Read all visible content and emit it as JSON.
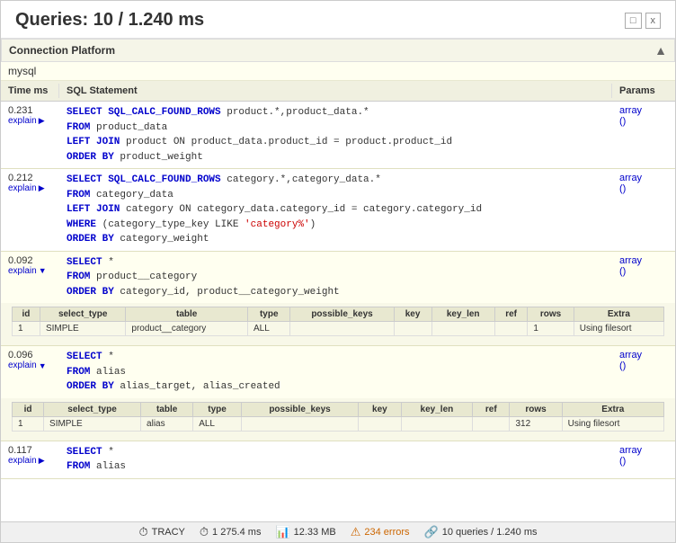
{
  "title": "Queries: 10 / 1.240 ms",
  "window_controls": [
    "□",
    "x"
  ],
  "connection": {
    "platform_label": "Connection Platform",
    "db_name": "mysql"
  },
  "table_headers": {
    "time": "Time ms",
    "sql": "SQL Statement",
    "params": "Params"
  },
  "queries": [
    {
      "id": "q1",
      "time": "0.231",
      "explain_label": "explain",
      "explain_open": false,
      "sql_lines": [
        {
          "type": "keyword",
          "text": "SELECT SQL_CALC_FOUND_ROWS ",
          "rest": "product.*,product_data.*"
        },
        {
          "type": "keyword2",
          "text": "FROM ",
          "rest": "product_data"
        },
        {
          "type": "keyword2",
          "text": "LEFT JOIN ",
          "rest": "product ON product_data.product_id = product.product_id"
        },
        {
          "type": "keyword2",
          "text": "ORDER BY ",
          "rest": "product_weight"
        }
      ],
      "params": "array\n()"
    },
    {
      "id": "q2",
      "time": "0.212",
      "explain_label": "explain",
      "explain_open": false,
      "sql_lines": [
        {
          "type": "keyword",
          "text": "SELECT SQL_CALC_FOUND_ROWS ",
          "rest": "category.*,category_data.*"
        },
        {
          "type": "keyword2",
          "text": "FROM ",
          "rest": "category_data"
        },
        {
          "type": "keyword2",
          "text": "LEFT JOIN ",
          "rest": "category ON category_data.category_id = category.category_id"
        },
        {
          "type": "keyword2",
          "text": "WHERE ",
          "rest": "(category_type_key LIKE 'category%')"
        },
        {
          "type": "keyword2",
          "text": "ORDER BY ",
          "rest": "category_weight"
        }
      ],
      "params": "array\n()"
    },
    {
      "id": "q3",
      "time": "0.092",
      "explain_label": "explain",
      "explain_open": true,
      "sql_lines": [
        {
          "type": "keyword",
          "text": "SELECT ",
          "rest": "*"
        },
        {
          "type": "keyword2",
          "text": "FROM ",
          "rest": "product__category"
        },
        {
          "type": "keyword2",
          "text": "ORDER BY ",
          "rest": "category_id, product__category_weight"
        }
      ],
      "params": "array\n()",
      "explain_data": {
        "headers": [
          "id",
          "select_type",
          "table",
          "type",
          "possible_keys",
          "key",
          "key_len",
          "ref",
          "rows",
          "Extra"
        ],
        "rows": [
          [
            "1",
            "SIMPLE",
            "product__category",
            "ALL",
            "",
            "",
            "",
            "",
            "1",
            "Using filesort"
          ]
        ]
      }
    },
    {
      "id": "q4",
      "time": "0.096",
      "explain_label": "explain",
      "explain_open": true,
      "sql_lines": [
        {
          "type": "keyword",
          "text": "SELECT ",
          "rest": "*"
        },
        {
          "type": "keyword2",
          "text": "FROM ",
          "rest": "alias"
        },
        {
          "type": "keyword2",
          "text": "ORDER BY ",
          "rest": "alias_target, alias_created"
        }
      ],
      "params": "array\n()",
      "explain_data": {
        "headers": [
          "id",
          "select_type",
          "table",
          "type",
          "possible_keys",
          "key",
          "key_len",
          "ref",
          "rows",
          "Extra"
        ],
        "rows": [
          [
            "1",
            "SIMPLE",
            "alias",
            "ALL",
            "",
            "",
            "",
            "",
            "312",
            "Using filesort"
          ]
        ]
      }
    },
    {
      "id": "q5",
      "time": "0.117",
      "explain_label": "explain",
      "explain_open": false,
      "sql_lines": [
        {
          "type": "keyword",
          "text": "SELECT ",
          "rest": "*"
        },
        {
          "type": "keyword2",
          "text": "FROM ",
          "rest": "alias"
        }
      ],
      "params": "array\n()"
    }
  ],
  "status_bar": {
    "tracy_label": "TRACY",
    "time": "1 275.4 ms",
    "memory": "12.33 MB",
    "errors_label": "234 errors",
    "queries_label": "10 queries / 1.240 ms"
  }
}
